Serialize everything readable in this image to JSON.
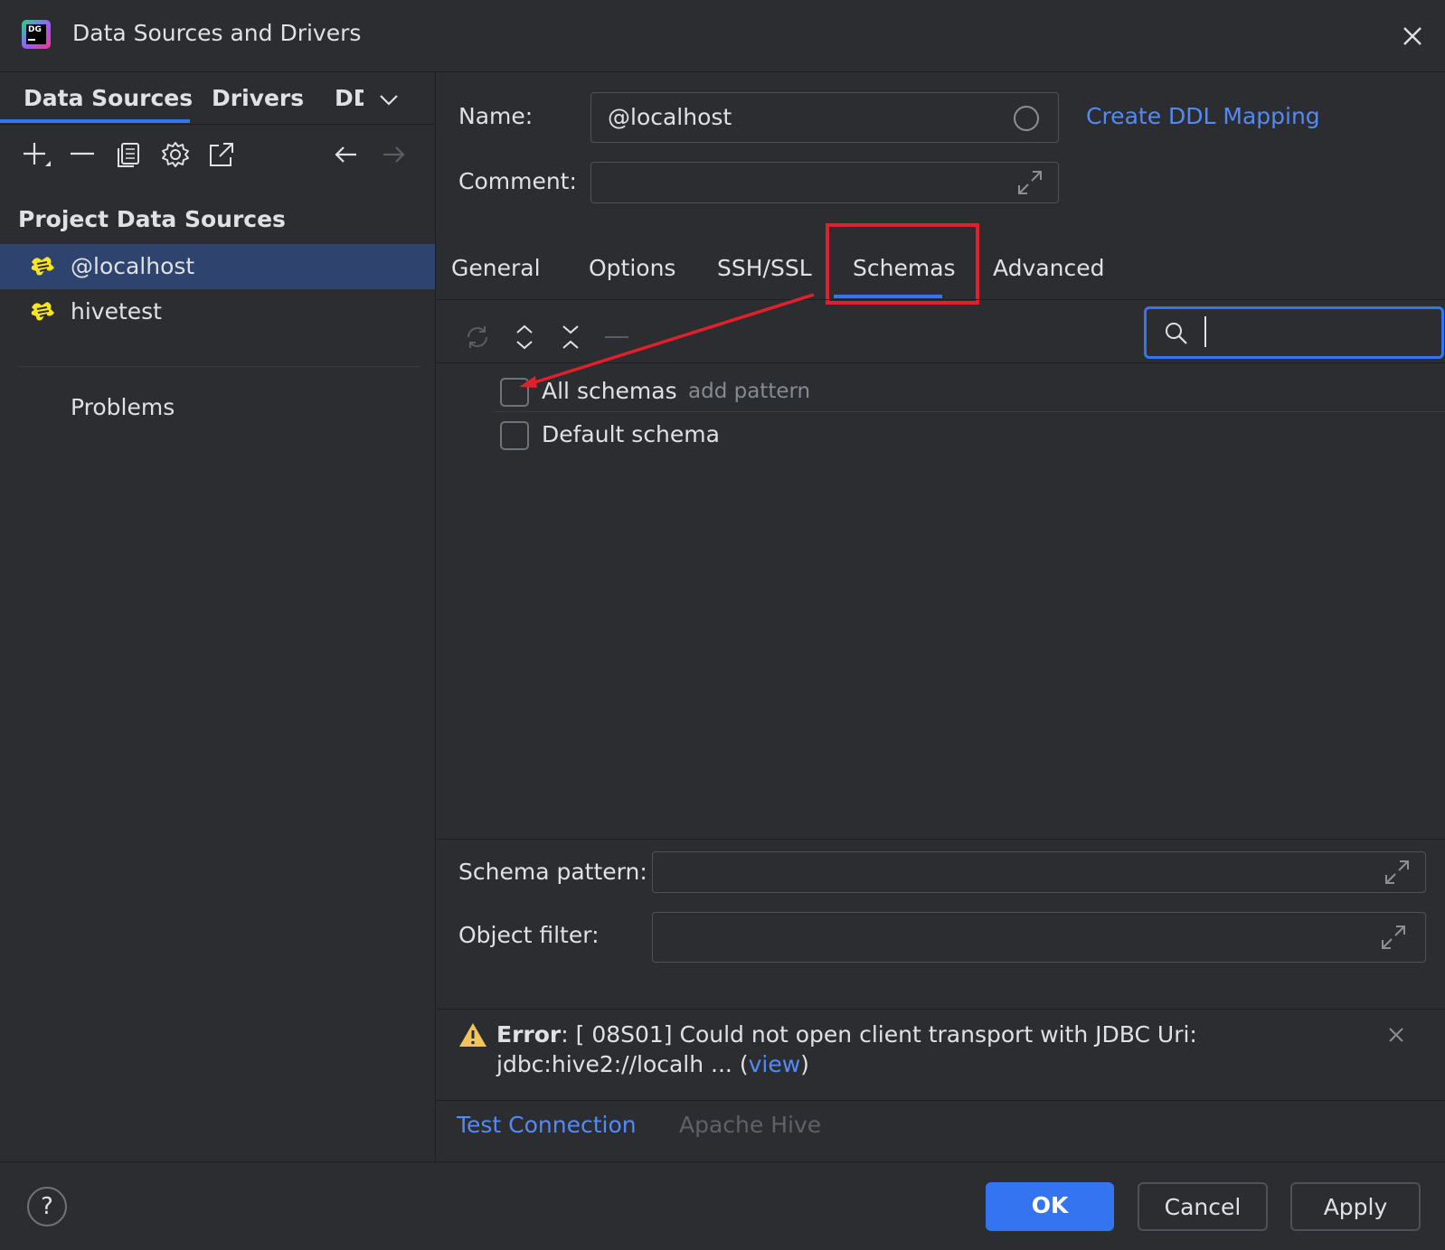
{
  "window": {
    "title": "Data Sources and Drivers",
    "logo_text": "DG"
  },
  "left": {
    "tabs": [
      "Data Sources",
      "Drivers",
      "DD"
    ],
    "section_title": "Project Data Sources",
    "items": [
      {
        "label": "@localhost",
        "selected": true
      },
      {
        "label": "hivetest",
        "selected": false
      }
    ],
    "problems": "Problems"
  },
  "form": {
    "name_label": "Name:",
    "name_value": "@localhost",
    "comment_label": "Comment:",
    "comment_value": "",
    "ddl_link": "Create DDL Mapping"
  },
  "tabs": [
    "General",
    "Options",
    "SSH/SSL",
    "Schemas",
    "Advanced"
  ],
  "active_tab": "Schemas",
  "schemas": {
    "search_value": "",
    "rows": [
      {
        "label": "All schemas",
        "hint": "add pattern",
        "checked": false
      },
      {
        "label": "Default schema",
        "hint": "",
        "checked": false
      }
    ],
    "schema_pattern_label": "Schema pattern:",
    "schema_pattern_value": "",
    "object_filter_label": "Object filter:",
    "object_filter_value": ""
  },
  "error": {
    "title": "Error",
    "message": ": [ 08S01] Could not open client transport with JDBC Uri:",
    "detail": "jdbc:hive2://localh ... (",
    "view_link": "view",
    "detail_end": ")"
  },
  "bottom_bar": {
    "test_connection": "Test Connection",
    "driver": "Apache Hive"
  },
  "buttons": {
    "help": "?",
    "ok": "OK",
    "cancel": "Cancel",
    "apply": "Apply"
  },
  "colors": {
    "background": "#2b2d30",
    "accent": "#3574f0",
    "link": "#548af7",
    "selection": "#2e436e",
    "annotation_red": "#e0202a",
    "warning": "#f2c55c"
  }
}
